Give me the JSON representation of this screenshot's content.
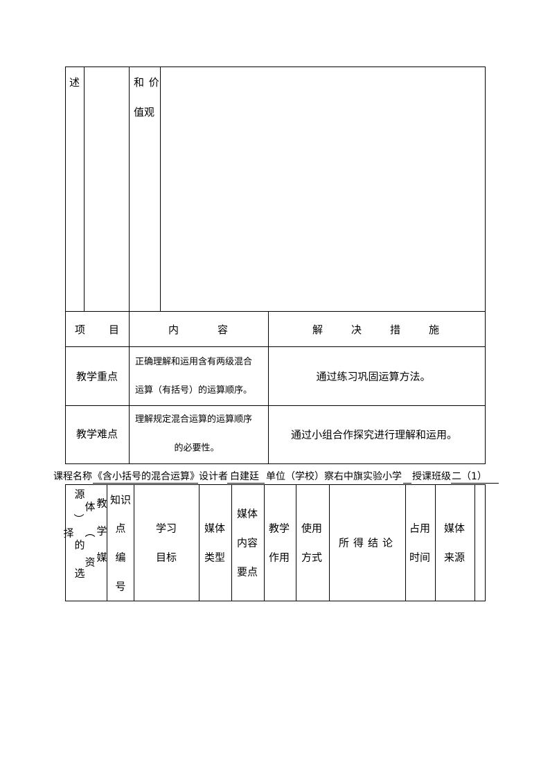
{
  "top_table": {
    "col1_text": "述",
    "col3_line1": "和 价",
    "col3_line2": "值观"
  },
  "key_points_table": {
    "headers": [
      "项　　　目",
      "内　　　容",
      "解　　决　　措　　施"
    ],
    "header_item": "项",
    "header_item_b": "目",
    "header_content": "内",
    "header_content_b": "容",
    "header_solution": [
      "解",
      "决",
      "措",
      "施"
    ],
    "rows": [
      {
        "item": "教学重点",
        "content_line1": "正确理解和运用含有两级混合",
        "content_line2": "运算（有括号）的运算顺序。",
        "solution": "通过练习巩固运算方法。"
      },
      {
        "item": "教学难点",
        "content_line1": "理解规定混合运算的运算顺序",
        "content_line2": "的必要性。",
        "solution": "通过小组合作探究进行理解和运用。"
      }
    ]
  },
  "course_info": {
    "course_label": "课程名称",
    "course_name": "《含小括号的混合运算》",
    "designer_label": "设计者",
    "designer": "白建廷",
    "unit_label": "单位（学校）",
    "unit": "察右中旗实验小学",
    "class_label": "授课班级",
    "class": "二（1）"
  },
  "media_table": {
    "first_header_chars": [
      "源",
      "体",
      "教",
      "︶",
      "择",
      "︵",
      "学",
      "的",
      "资",
      "媒",
      "选"
    ],
    "headers": [
      {
        "lines": [
          "知识",
          "点",
          "编",
          "号"
        ]
      },
      {
        "lines": [
          "学习",
          "目标"
        ]
      },
      {
        "lines": [
          "媒体",
          "类型"
        ]
      },
      {
        "lines": [
          "媒体",
          "内容",
          "要点"
        ]
      },
      {
        "lines": [
          "教学",
          "作用"
        ]
      },
      {
        "lines": [
          "使用",
          "方式"
        ]
      },
      {
        "lines": [
          "所得结论"
        ]
      },
      {
        "lines": [
          "占用",
          "时间"
        ]
      },
      {
        "lines": [
          "媒体",
          "来源"
        ]
      },
      {
        "lines": [
          ""
        ]
      }
    ]
  }
}
